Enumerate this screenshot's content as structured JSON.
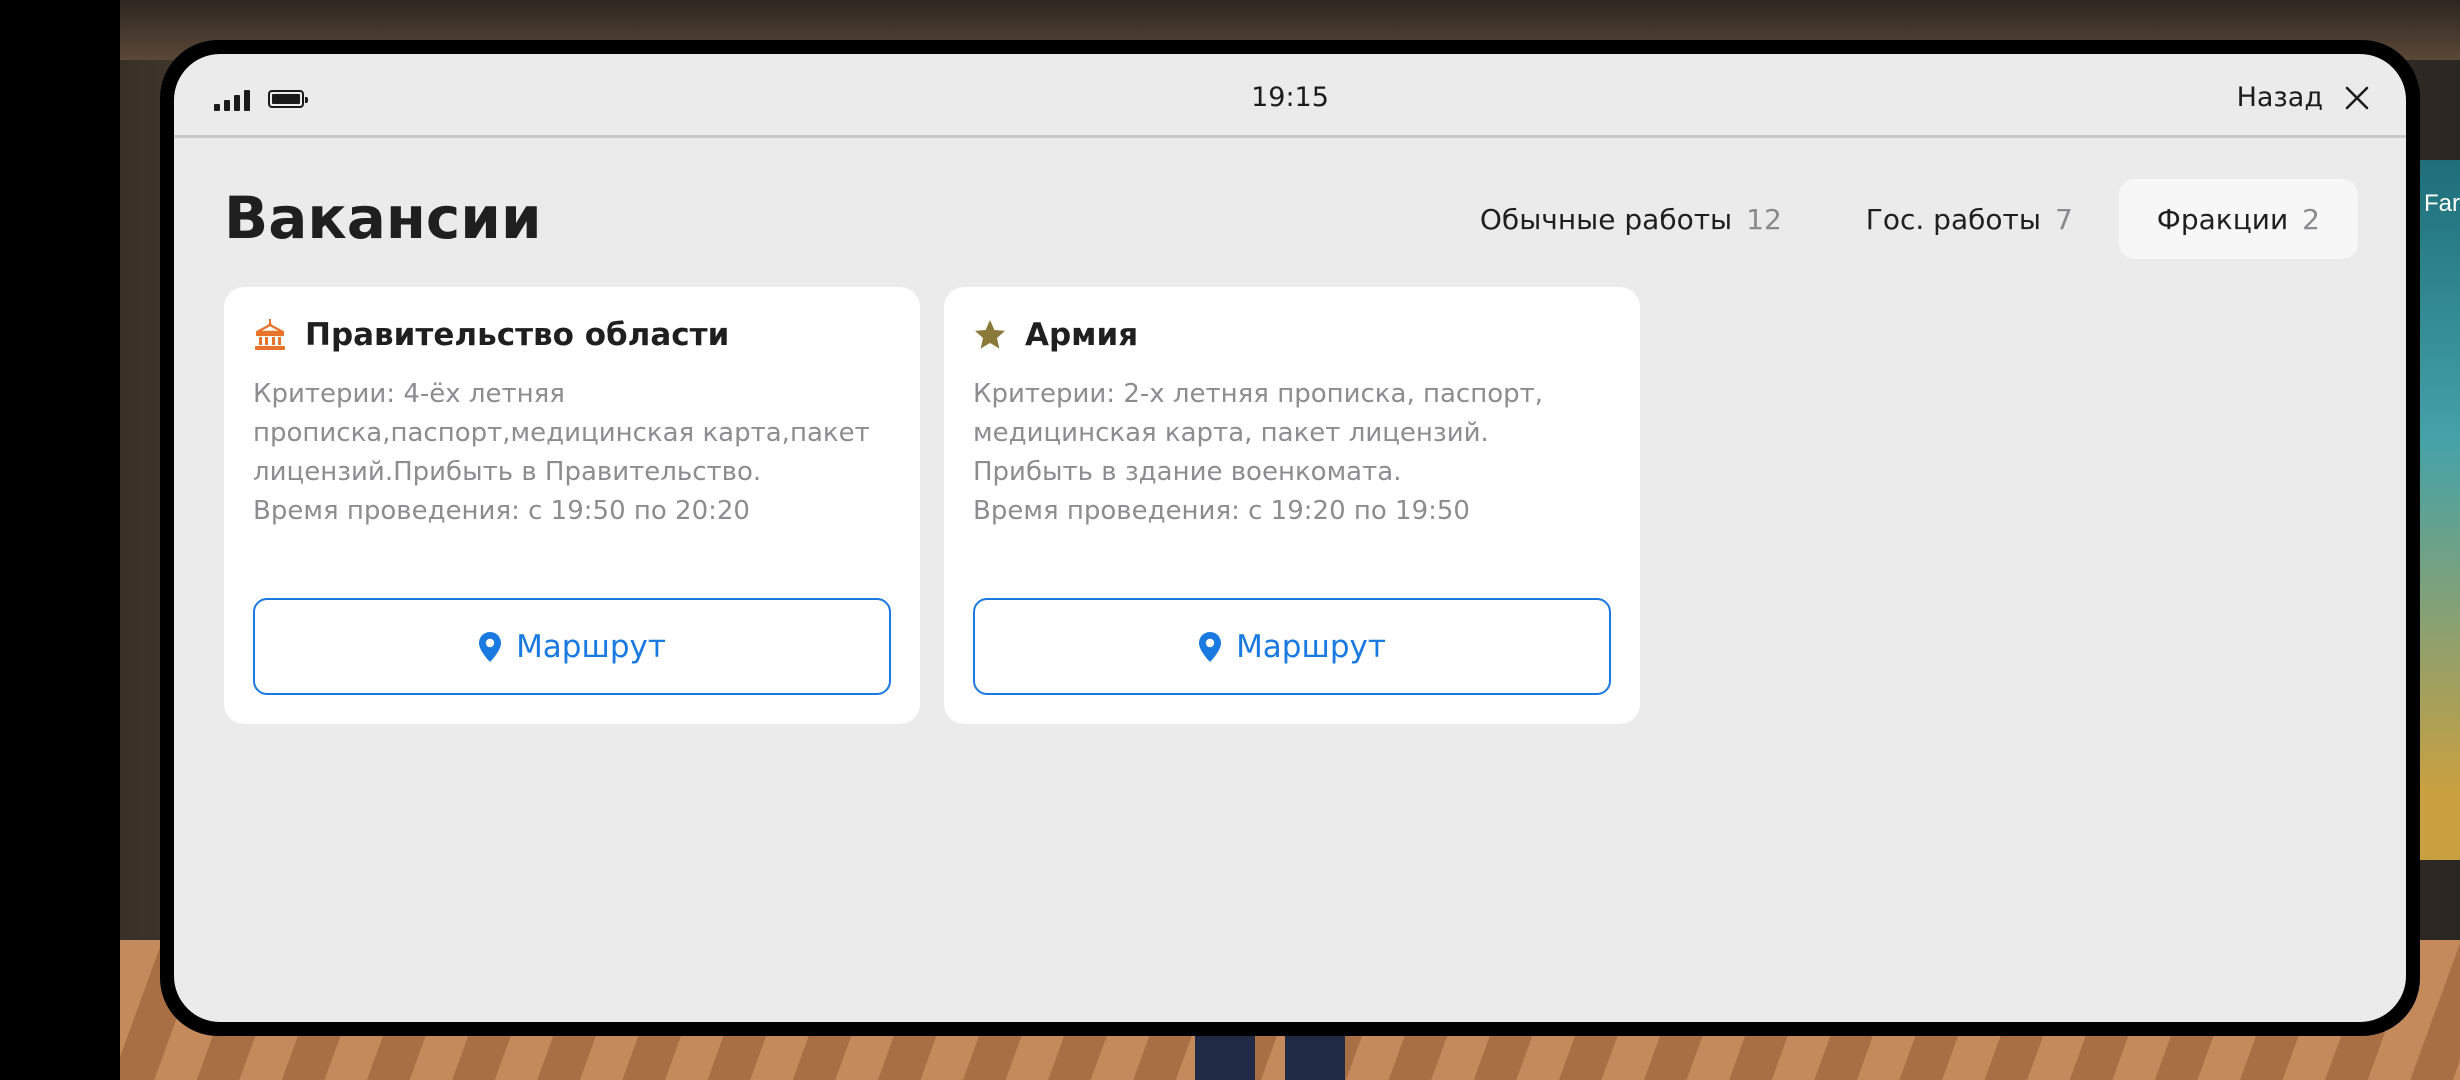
{
  "status_bar": {
    "time": "19:15",
    "back_label": "Назад"
  },
  "page": {
    "title": "Вакансии"
  },
  "tabs": [
    {
      "label": "Обычные работы",
      "count": "12",
      "active": false
    },
    {
      "label": "Гос. работы",
      "count": "7",
      "active": false
    },
    {
      "label": "Фракции",
      "count": "2",
      "active": true
    }
  ],
  "cards": [
    {
      "icon": "government-building-icon",
      "title": "Правительство области",
      "description": "Критерии: 4-ёх летняя\nпрописка,паспорт,медицинская карта,пакет\nлицензий.Прибыть в Правительство.\nВремя проведения: с 19:50 по 20:20",
      "button_label": "Маршрут"
    },
    {
      "icon": "star-icon",
      "title": "Армия",
      "description": "Критерии: 2-х летняя прописка, паспорт,\nмедицинская карта, пакет лицензий.\nПрибыть в здание военкомата.\nВремя проведения: с 19:20 по 19:50",
      "button_label": "Маршрут"
    }
  ],
  "background": {
    "visible_text": "Far"
  },
  "colors": {
    "accent": "#1a7ae0",
    "government_icon": "#e8742c",
    "star_icon": "#8a7a3a",
    "panel_background": "#ecebec",
    "card_background": "#ffffff"
  }
}
